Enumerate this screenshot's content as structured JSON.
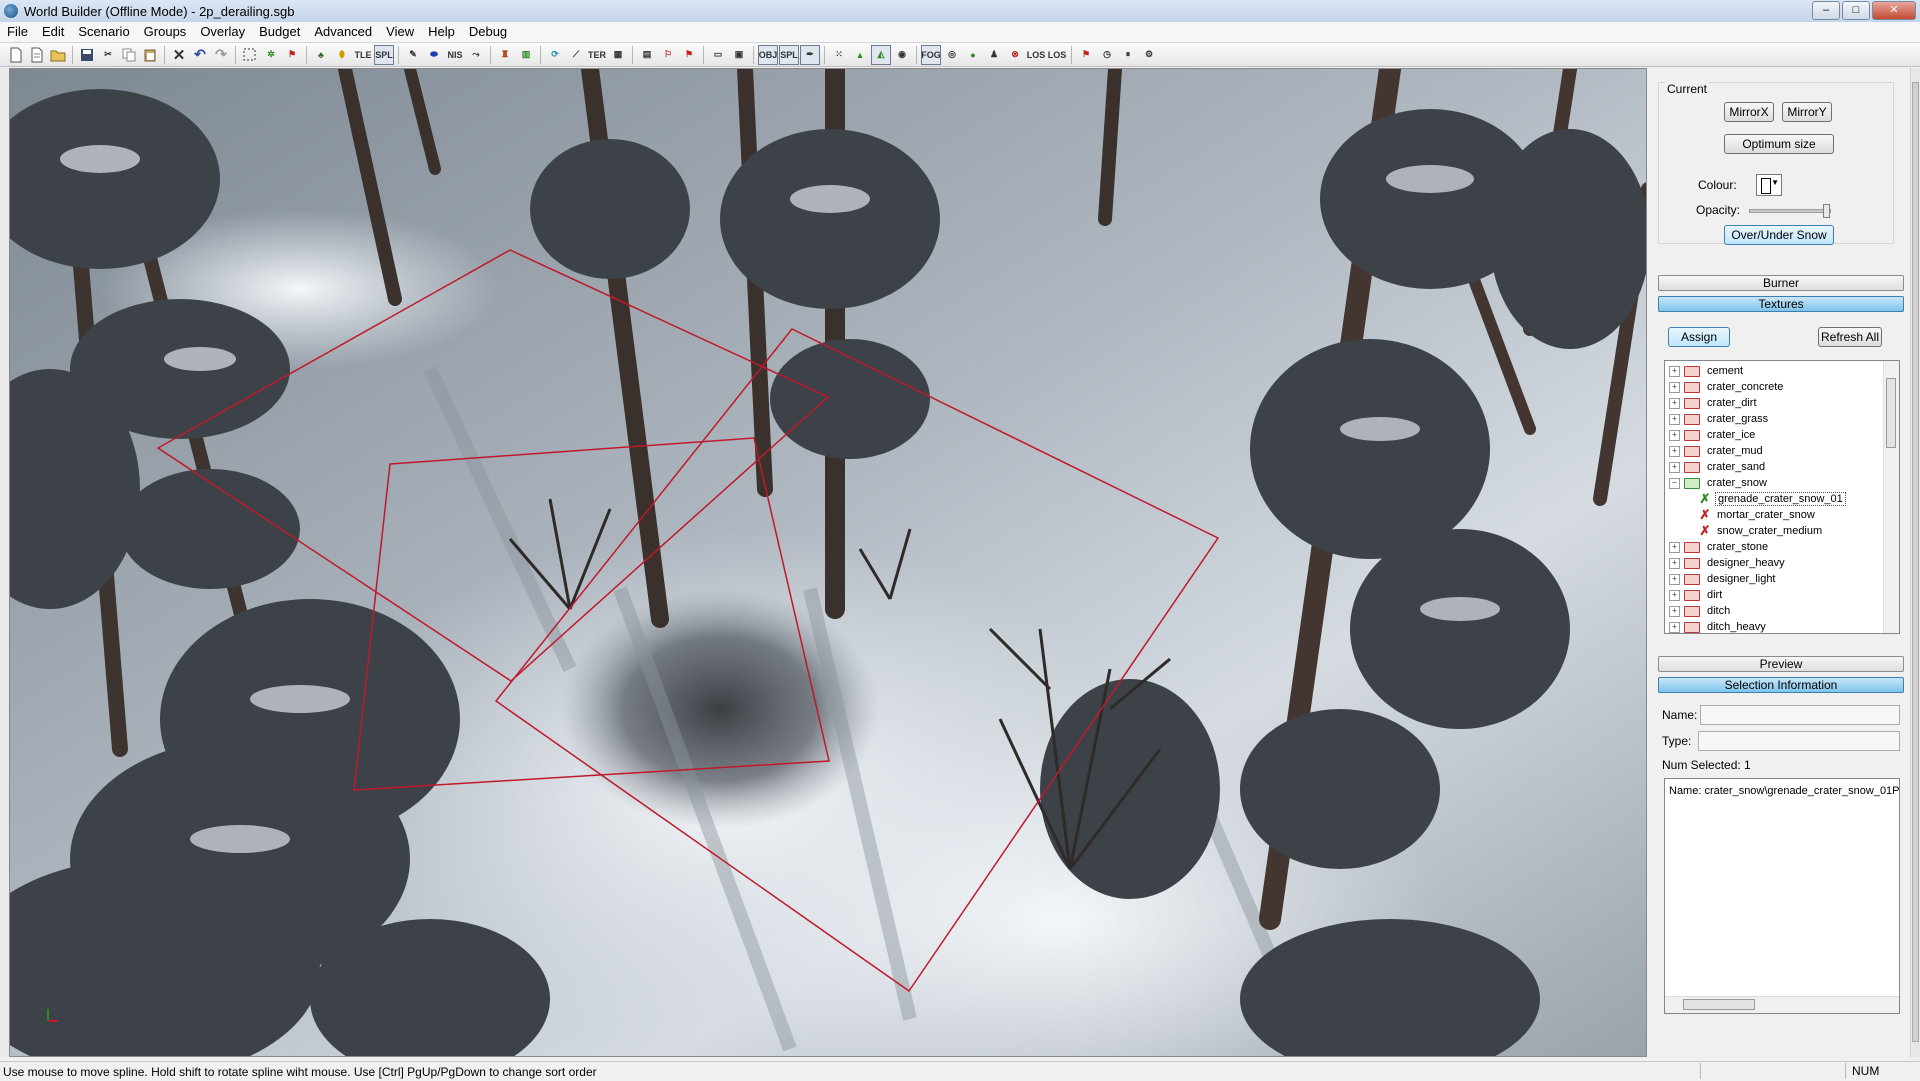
{
  "window": {
    "title": "World Builder (Offline Mode) - 2p_derailing.sgb",
    "minimize": "–",
    "maximize": "□",
    "close": "✕"
  },
  "menu": [
    "File",
    "Edit",
    "Scenario",
    "Groups",
    "Overlay",
    "Budget",
    "Advanced",
    "View",
    "Help",
    "Debug"
  ],
  "toolbar": {
    "tle": "TLE",
    "spl": "SPL",
    "nis": "NIS",
    "ter": "TER",
    "obj": "OBJ",
    "spl2": "SPL",
    "fog": "FOG",
    "los": "LOS",
    "los2": "LOS"
  },
  "panel": {
    "current_label": "Current",
    "mirror_x": "MirrorX",
    "mirror_y": "MirrorY",
    "optimum_size": "Optimum size",
    "colour_label": "Colour:",
    "opacity_label": "Opacity:",
    "opacity_value": 0.95,
    "over_under_snow": "Over/Under Snow",
    "burner": "Burner",
    "textures": "Textures",
    "assign": "Assign",
    "refresh_all": "Refresh All",
    "tree": [
      {
        "label": "cement",
        "type": "folder"
      },
      {
        "label": "crater_concrete",
        "type": "folder"
      },
      {
        "label": "crater_dirt",
        "type": "folder"
      },
      {
        "label": "crater_grass",
        "type": "folder"
      },
      {
        "label": "crater_ice",
        "type": "folder"
      },
      {
        "label": "crater_mud",
        "type": "folder"
      },
      {
        "label": "crater_sand",
        "type": "folder"
      },
      {
        "label": "crater_snow",
        "type": "folder-open"
      },
      {
        "label": "grenade_crater_snow_01",
        "type": "item-selected"
      },
      {
        "label": "mortar_crater_snow",
        "type": "item"
      },
      {
        "label": "snow_crater_medium",
        "type": "item"
      },
      {
        "label": "crater_stone",
        "type": "folder"
      },
      {
        "label": "designer_heavy",
        "type": "folder"
      },
      {
        "label": "designer_light",
        "type": "folder"
      },
      {
        "label": "dirt",
        "type": "folder"
      },
      {
        "label": "ditch",
        "type": "folder"
      },
      {
        "label": "ditch_heavy",
        "type": "folder"
      }
    ],
    "preview": "Preview",
    "selection_information": "Selection Information",
    "name_label": "Name:",
    "type_label": "Type:",
    "num_selected": "Num Selected: 1",
    "info_text": "Name: crater_snow\\grenade_crater_snow_01P"
  },
  "status": {
    "message": "Use mouse to move spline. Hold shift to rotate spline wiht mouse. Use [Ctrl] PgUp/PgDown to change sort order",
    "num": "NUM"
  }
}
